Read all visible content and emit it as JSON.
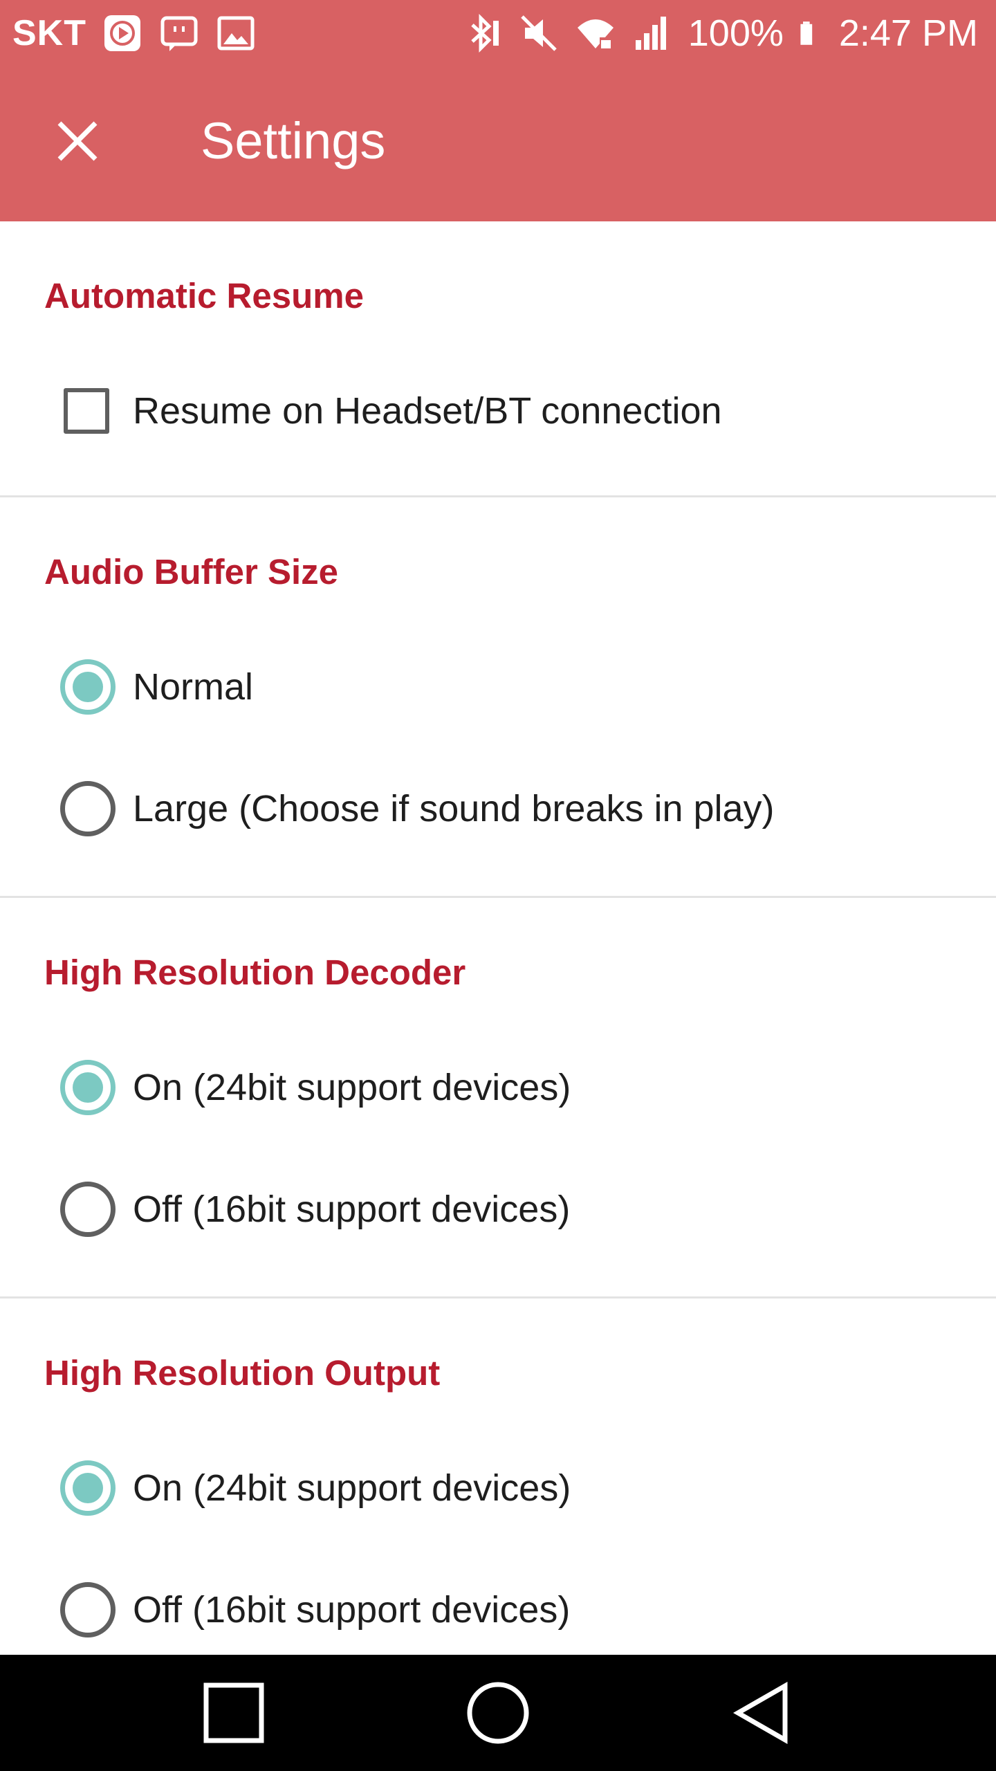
{
  "status_bar": {
    "carrier": "SKT",
    "battery": "100%",
    "time": "2:47 PM",
    "icons": [
      "play-store-icon",
      "messenger-icon",
      "gallery-icon",
      "bluetooth-icon",
      "mute-icon",
      "wifi-icon",
      "signal-icon",
      "battery-icon"
    ]
  },
  "app_bar": {
    "title": "Settings",
    "close_icon": "close-icon"
  },
  "sections": [
    {
      "title": "Automatic Resume",
      "options": [
        {
          "type": "checkbox",
          "label": "Resume on Headset/BT connection",
          "checked": false
        }
      ]
    },
    {
      "title": "Audio Buffer Size",
      "options": [
        {
          "type": "radio",
          "label": "Normal",
          "checked": true
        },
        {
          "type": "radio",
          "label": "Large (Choose if sound breaks in play)",
          "checked": false
        }
      ]
    },
    {
      "title": "High Resolution Decoder",
      "options": [
        {
          "type": "radio",
          "label": "On (24bit support devices)",
          "checked": true
        },
        {
          "type": "radio",
          "label": "Off (16bit support devices)",
          "checked": false
        }
      ]
    },
    {
      "title": "High Resolution Output",
      "options": [
        {
          "type": "radio",
          "label": "On (24bit support devices)",
          "checked": true
        },
        {
          "type": "radio",
          "label": "Off (16bit support devices)",
          "checked": false
        }
      ]
    }
  ],
  "nav_bar": {
    "icons": [
      "recents-square-icon",
      "home-circle-icon",
      "back-triangle-icon"
    ]
  },
  "colors": {
    "app_bar": "#d86163",
    "section_title": "#b71c2e",
    "radio_checked": "#7cc9c2"
  }
}
